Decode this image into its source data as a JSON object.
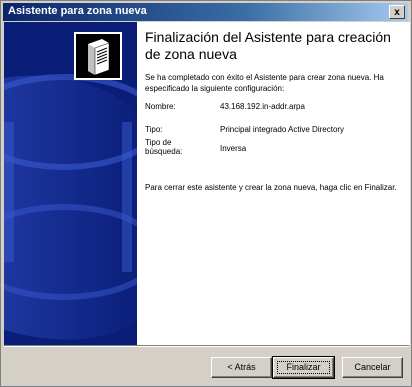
{
  "window": {
    "title": "Asistente para zona nueva",
    "close_label": "x"
  },
  "page": {
    "heading": "Finalización del Asistente para creación de zona nueva",
    "intro": "Se ha completado con éxito el Asistente para crear zona nueva. Ha especificado la siguiente configuración:",
    "settings": [
      {
        "label": "Nombre:",
        "value": "43.168.192.in-addr.arpa"
      },
      {
        "label": "Tipo:",
        "value": "Principal integrado Active Directory"
      },
      {
        "label": "Tipo de búsqueda:",
        "value": "Inversa"
      }
    ],
    "outro": "Para cerrar este asistente y crear la zona nueva, haga clic en Finalizar."
  },
  "buttons": {
    "back": "< Atrás",
    "finish": "Finalizar",
    "cancel": "Cancelar"
  },
  "banner": {
    "icon": "server-icon"
  },
  "colors": {
    "banner": "#0a1e78",
    "title_start": "#0a246a",
    "title_end": "#a6caf0"
  }
}
